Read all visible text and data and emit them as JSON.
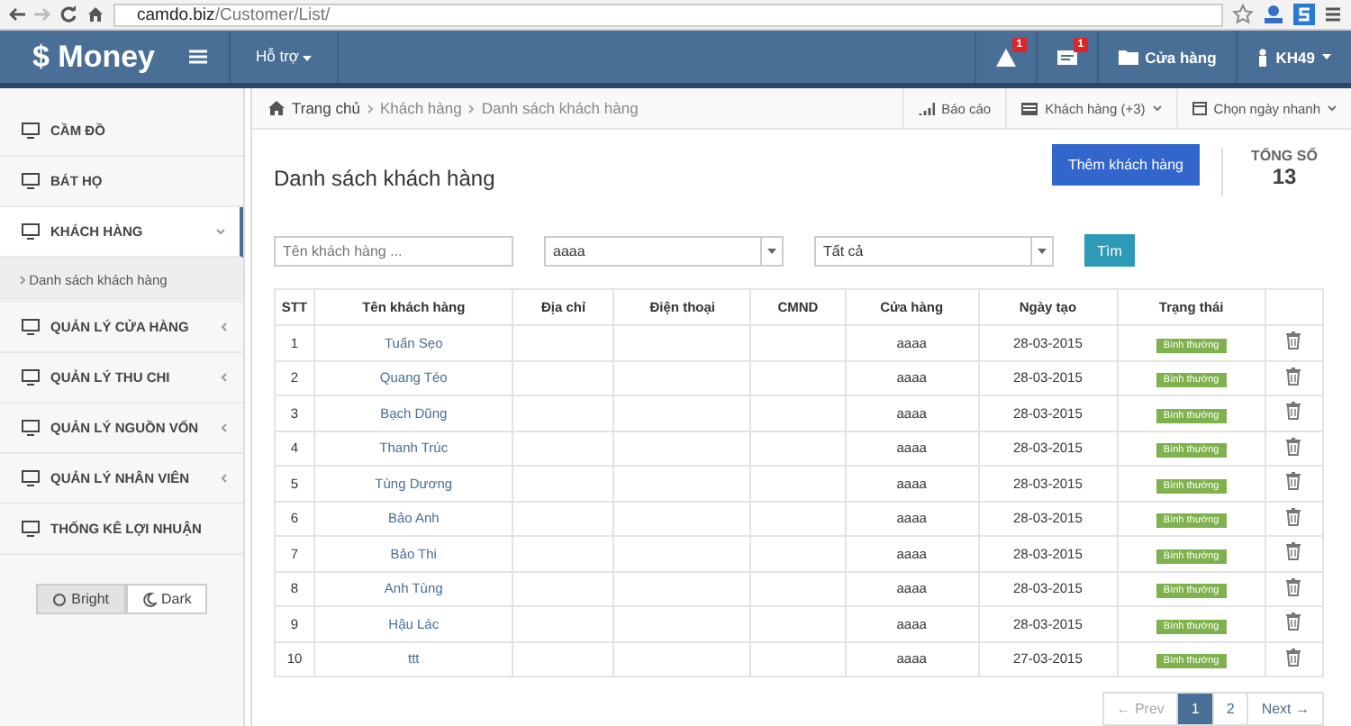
{
  "browser": {
    "url": "**camdo.biz**/Customer/List/"
  },
  "header": {
    "logo": "$ Money",
    "menu": [
      {
        "label": "Hỗ trợ"
      }
    ],
    "notifications": [
      {
        "kind": "alert",
        "badge": "1"
      },
      {
        "kind": "inbox",
        "badge": "1"
      }
    ],
    "store": "Cửa hàng",
    "user": "KH49"
  },
  "sidebar": {
    "items": [
      {
        "label": "CẦM ĐỒ",
        "expanded": false,
        "has_children": false
      },
      {
        "label": "BÁT HỌ",
        "expanded": false,
        "has_children": false
      },
      {
        "label": "KHÁCH HÀNG",
        "expanded": true,
        "has_children": true,
        "children": [
          {
            "label": "Danh sách khách hàng"
          }
        ]
      },
      {
        "label": "QUẢN LÝ CỬA HÀNG",
        "expanded": false,
        "has_children": true
      },
      {
        "label": "QUẢN LÝ THU CHI",
        "expanded": false,
        "has_children": true
      },
      {
        "label": "QUẢN LÝ NGUỒN VỐN",
        "expanded": false,
        "has_children": true
      },
      {
        "label": "QUẢN LÝ NHÂN VIÊN",
        "expanded": false,
        "has_children": true
      },
      {
        "label": "THỐNG KÊ LỢI NHUẬN",
        "expanded": false,
        "has_children": false
      }
    ],
    "theme": [
      {
        "label": "Bright",
        "kind": "sun",
        "selected": true
      },
      {
        "label": "Dark",
        "kind": "moon",
        "selected": false
      }
    ]
  },
  "breadcrumb": [
    "Trang chủ",
    "Khách hàng",
    "Danh sách khách hàng"
  ],
  "toolbar": [
    {
      "label": "Báo cáo",
      "kind": "chart",
      "dropdown": false
    },
    {
      "label": "Khách hàng (+3)",
      "kind": "list",
      "dropdown": true
    },
    {
      "label": "Chọn ngày nhanh",
      "kind": "calendar",
      "dropdown": true
    }
  ],
  "page": {
    "title": "Danh sách khách hàng",
    "add_button": "Thêm khách hàng",
    "total_label": "TỔNG SỐ",
    "total": "13"
  },
  "filters": {
    "name": {
      "placeholder": "Tên khách hàng ..."
    },
    "store": {
      "value": "aaaa"
    },
    "status": {
      "value": "Tất cả"
    },
    "search_button": "Tìm"
  },
  "table": {
    "columns": [
      "STT",
      "Tên khách hàng",
      "Địa chỉ",
      "Điện thoại",
      "CMND",
      "Cửa hàng",
      "Ngày tạo",
      "Trạng thái"
    ],
    "rows": [
      {
        "stt": "1",
        "name": "Tuấn Sẹo",
        "store": "aaaa",
        "date": "28-03-2015",
        "status": "Bình thường"
      },
      {
        "stt": "2",
        "name": "Quang Téo",
        "store": "aaaa",
        "date": "28-03-2015",
        "status": "Bình thường"
      },
      {
        "stt": "3",
        "name": "Bạch Dũng",
        "store": "aaaa",
        "date": "28-03-2015",
        "status": "Bình thường"
      },
      {
        "stt": "4",
        "name": "Thanh Trúc",
        "store": "aaaa",
        "date": "28-03-2015",
        "status": "Bình thường"
      },
      {
        "stt": "5",
        "name": "Tùng Dương",
        "store": "aaaa",
        "date": "28-03-2015",
        "status": "Bình thường"
      },
      {
        "stt": "6",
        "name": "Bảo Anh",
        "store": "aaaa",
        "date": "28-03-2015",
        "status": "Bình thường"
      },
      {
        "stt": "7",
        "name": "Bảo Thi",
        "store": "aaaa",
        "date": "28-03-2015",
        "status": "Bình thường"
      },
      {
        "stt": "8",
        "name": "Anh Tùng",
        "store": "aaaa",
        "date": "28-03-2015",
        "status": "Bình thường"
      },
      {
        "stt": "9",
        "name": "Hậu Lác",
        "store": "aaaa",
        "date": "28-03-2015",
        "status": "Bình thường"
      },
      {
        "stt": "10",
        "name": "ttt",
        "store": "aaaa",
        "date": "27-03-2015",
        "status": "Bình thường"
      }
    ]
  },
  "pagination": [
    {
      "label": "← Prev",
      "selected": false,
      "disabled": true
    },
    {
      "label": "1",
      "selected": true,
      "disabled": false
    },
    {
      "label": "2",
      "selected": false,
      "disabled": false
    },
    {
      "label": "Next →",
      "selected": false,
      "disabled": false
    }
  ]
}
